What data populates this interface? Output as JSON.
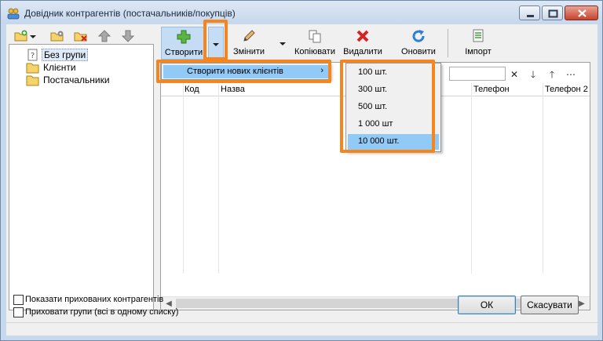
{
  "window": {
    "title": "Довідник контрагентів (постачальників/покупців)"
  },
  "tree": {
    "items": [
      {
        "label": "Без групи",
        "icon": "question-folder-icon",
        "selected": true
      },
      {
        "label": "Клієнти",
        "icon": "folder-icon",
        "selected": false
      },
      {
        "label": "Постачальники",
        "icon": "folder-icon",
        "selected": false
      }
    ]
  },
  "toolbar": {
    "create": "Створити",
    "edit": "Змінити",
    "copy": "Копіювати",
    "delete": "Видалити",
    "refresh": "Оновити",
    "import": "Імпорт"
  },
  "grid": {
    "search_value": "",
    "columns": [
      "Код",
      "Назва",
      "Телефон",
      "Телефон 2"
    ]
  },
  "menu": {
    "create_new_clients": "Створити нових клієнтів",
    "quantities": [
      "100 шт.",
      "300 шт.",
      "500 шт.",
      "1 000 шт",
      "10 000 шт."
    ],
    "highlighted_index": 4
  },
  "bottom": {
    "show_hidden": "Показати прихованих контрагентів",
    "hide_groups": "Приховати групи (всі в одному списку)",
    "ok": "ОК",
    "cancel": "Скасувати"
  },
  "colors": {
    "accent_highlight": "#f5861f",
    "menu_selection": "#91c9f7"
  }
}
